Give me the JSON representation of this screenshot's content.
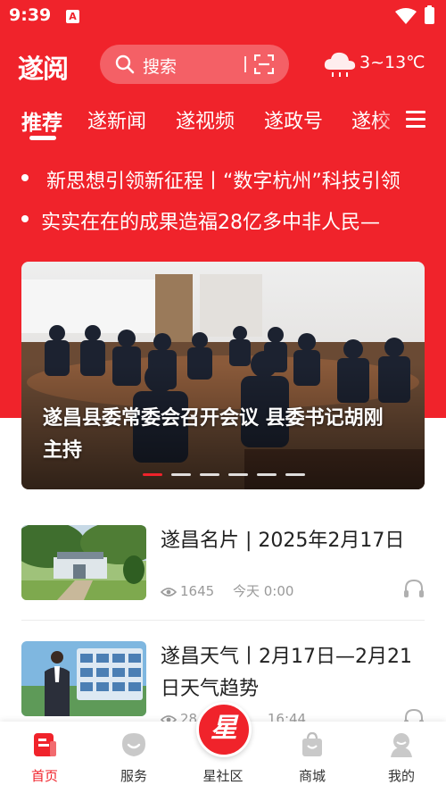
{
  "status_bar": {
    "time": "9:39",
    "app_icon": "A"
  },
  "header": {
    "logo": "遂阅",
    "search_placeholder": "搜索",
    "weather": "3~13℃",
    "weather_icon": "cloud-icon"
  },
  "tabs": [
    {
      "label": "推荐",
      "active": true
    },
    {
      "label": "遂新闻",
      "active": false
    },
    {
      "label": "遂视频",
      "active": false
    },
    {
      "label": "遂政号",
      "active": false
    },
    {
      "label": "遂校",
      "active": false
    }
  ],
  "headlines": [
    "新思想引领新征程丨“数字杭州”科技引领",
    "实实在在的成果造福28亿多中非人民—"
  ],
  "banner": {
    "caption": "遂昌县委常委会召开会议 县委书记胡刚主持",
    "slide_count": 6,
    "active_slide": 1
  },
  "news": [
    {
      "title": "遂昌名片 | 2025年2月17日",
      "views": "1645",
      "time": "今天 0:00"
    },
    {
      "title": "遂昌天气丨2月17日—2月21日天气趋势",
      "views": "28",
      "time": "16:44"
    }
  ],
  "bottom_nav": [
    {
      "label": "首页",
      "icon": "home-icon",
      "active": true
    },
    {
      "label": "服务",
      "icon": "service-icon",
      "active": false
    },
    {
      "label": "星社区",
      "icon": "star-community-icon",
      "active": false
    },
    {
      "label": "商城",
      "icon": "shopping-bag-icon",
      "active": false
    },
    {
      "label": "我的",
      "icon": "profile-icon",
      "active": false
    }
  ],
  "center_button": "星",
  "colors": {
    "brand_red": "#f0232b",
    "text_dark": "#222222",
    "text_meta": "#9a9a9a"
  }
}
